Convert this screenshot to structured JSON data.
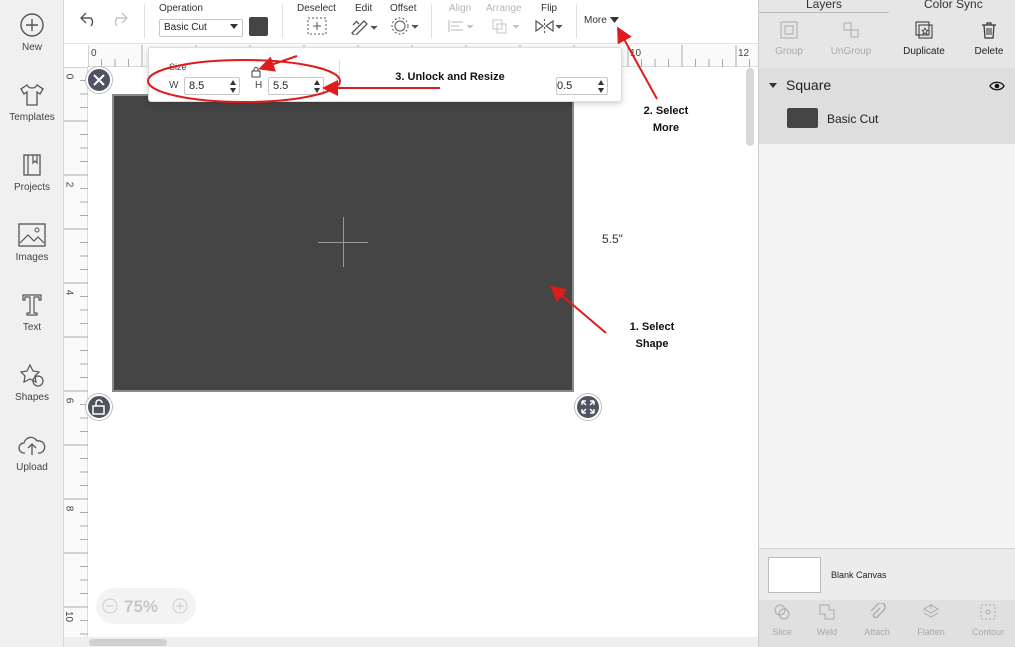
{
  "sidebar": {
    "items": [
      {
        "label": "New",
        "icon": "plus-circle-icon"
      },
      {
        "label": "Templates",
        "icon": "tshirt-icon"
      },
      {
        "label": "Projects",
        "icon": "bookmark-icon"
      },
      {
        "label": "Images",
        "icon": "image-icon"
      },
      {
        "label": "Text",
        "icon": "text-t-icon"
      },
      {
        "label": "Shapes",
        "icon": "shapes-icon"
      },
      {
        "label": "Upload",
        "icon": "cloud-upload-icon"
      }
    ]
  },
  "toolbar": {
    "operation_label": "Operation",
    "operation_value": "Basic Cut",
    "operation_color": "#454545",
    "deselect_label": "Deselect",
    "edit_label": "Edit",
    "offset_label": "Offset",
    "align_label": "Align",
    "arrange_label": "Arrange",
    "flip_label": "Flip",
    "more_label": "More"
  },
  "size_popup": {
    "title": "Size",
    "w_label": "W",
    "w_value": "8.5",
    "h_label": "H",
    "h_value": "5.5",
    "partial_value": "0.5"
  },
  "rulers": {
    "top": [
      "0",
      "10",
      "12"
    ],
    "left": [
      "0",
      "2",
      "4",
      "6",
      "8",
      "10"
    ]
  },
  "canvas": {
    "height_label": "5.5\"",
    "zoom": "75%",
    "shape_color": "#454545"
  },
  "right_panel": {
    "tabs": [
      "Layers",
      "Color Sync"
    ],
    "tools": [
      "Group",
      "UnGroup",
      "Duplicate",
      "Delete"
    ],
    "layer_name": "Square",
    "layer_operation": "Basic Cut",
    "blank_canvas_label": "Blank Canvas",
    "bottom_tools": [
      "Slice",
      "Weld",
      "Attach",
      "Flatten",
      "Contour"
    ]
  },
  "annotations": {
    "step1": [
      "1. Select",
      "Shape"
    ],
    "step2": [
      "2. Select",
      "More"
    ],
    "step3": "3. Unlock and Resize",
    "color": "#e01b1b"
  }
}
